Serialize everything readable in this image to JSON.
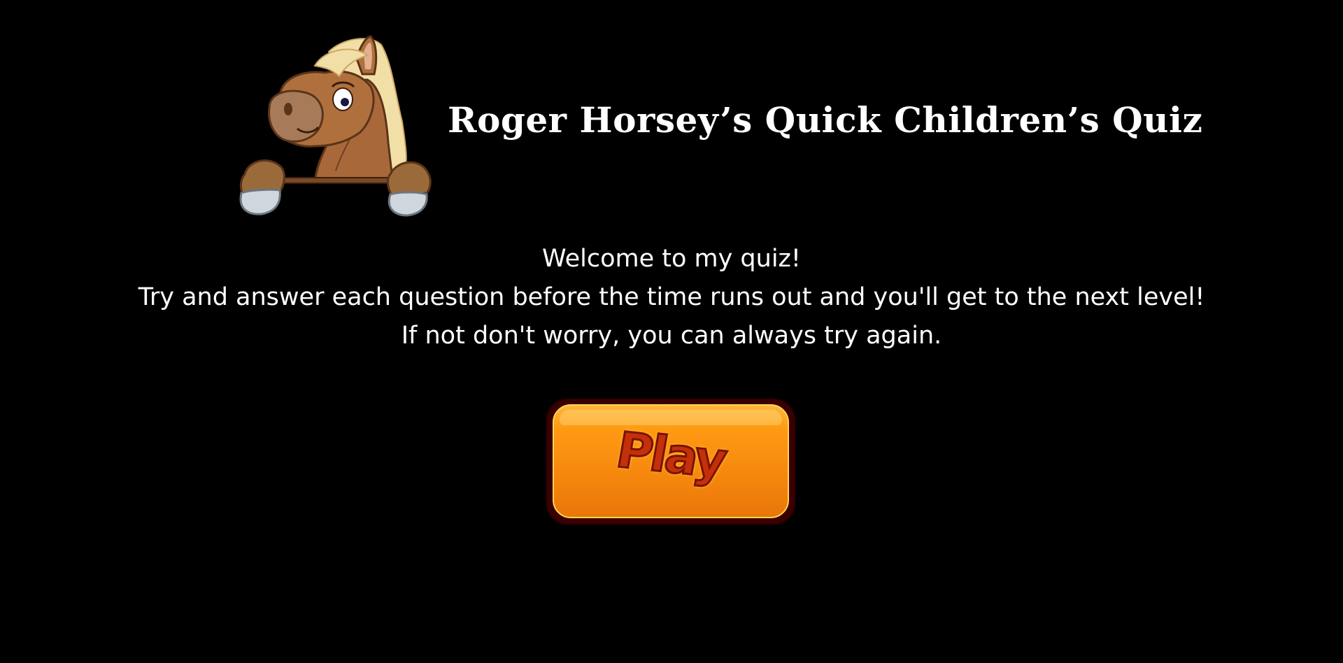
{
  "header": {
    "title": "Roger Horsey’s Quick Children’s Quiz",
    "mascot_icon": "horse-mascot-icon"
  },
  "intro": {
    "line1": "Welcome to my quiz!",
    "line2": "Try and answer each question before the time runs out and you'll get to the next level!",
    "line3": "If not don't worry, you can always try again."
  },
  "play_button": {
    "label": "Play"
  },
  "colors": {
    "background": "#000000",
    "text": "#ffffff",
    "button_orange": "#f4840c",
    "button_label": "#c4300a",
    "button_border": "#3a0000"
  }
}
